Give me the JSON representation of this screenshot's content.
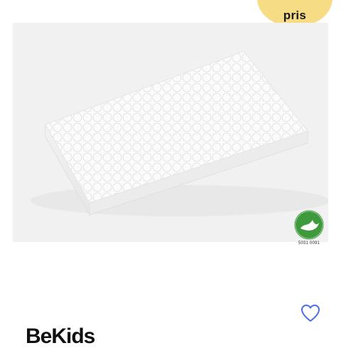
{
  "badge": {
    "text": "pris"
  },
  "product": {
    "eco_label": {
      "mark_text": "SVANEMÆRKET",
      "license_number": "5031 0091"
    }
  },
  "favorite": {
    "icon": "heart-icon"
  },
  "brand": {
    "name": "BeKids"
  },
  "colors": {
    "badge_bg": "#f7dc86",
    "image_bg": "#f1f1f1",
    "heart": "#4a6fe0",
    "eco_green": "#3e9a3c"
  }
}
